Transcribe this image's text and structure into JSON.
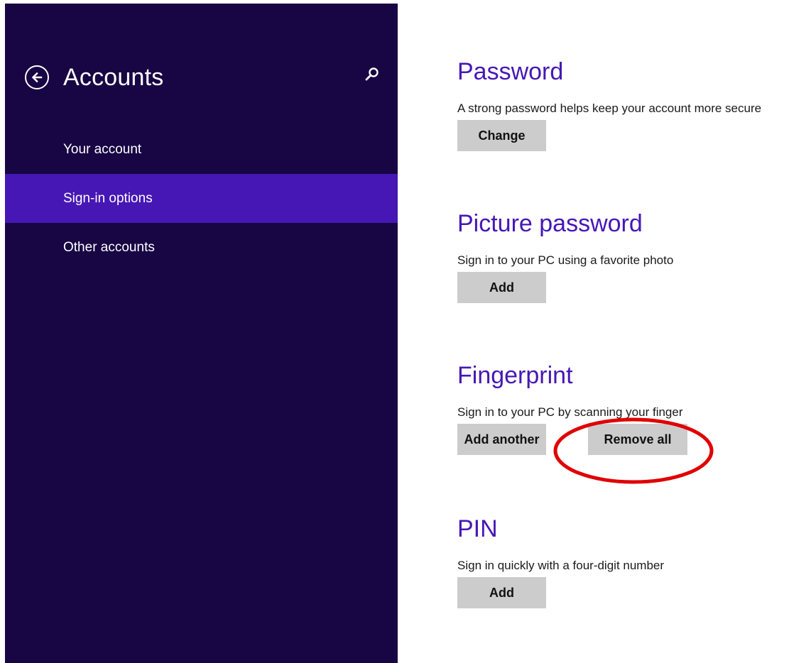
{
  "sidebar": {
    "title": "Accounts",
    "back_icon": "back-arrow-icon",
    "search_icon": "search-icon",
    "items": [
      {
        "label": "Your account",
        "selected": false
      },
      {
        "label": "Sign-in options",
        "selected": true
      },
      {
        "label": "Other accounts",
        "selected": false
      }
    ],
    "colors": {
      "background": "#180544",
      "selected": "#4617b5"
    }
  },
  "sections": {
    "password": {
      "title": "Password",
      "description": "A strong password helps keep your account more secure",
      "button": "Change"
    },
    "picture_password": {
      "title": "Picture password",
      "description": "Sign in to your PC using a favorite photo",
      "button": "Add"
    },
    "fingerprint": {
      "title": "Fingerprint",
      "description": "Sign in to your PC by scanning your finger",
      "button_add": "Add another",
      "button_remove": "Remove all"
    },
    "pin": {
      "title": "PIN",
      "description": "Sign in quickly with a four-digit number",
      "button": "Add"
    }
  },
  "colors": {
    "accent": "#4617b5",
    "button": "#cccccc",
    "annotation": "#e00000"
  }
}
